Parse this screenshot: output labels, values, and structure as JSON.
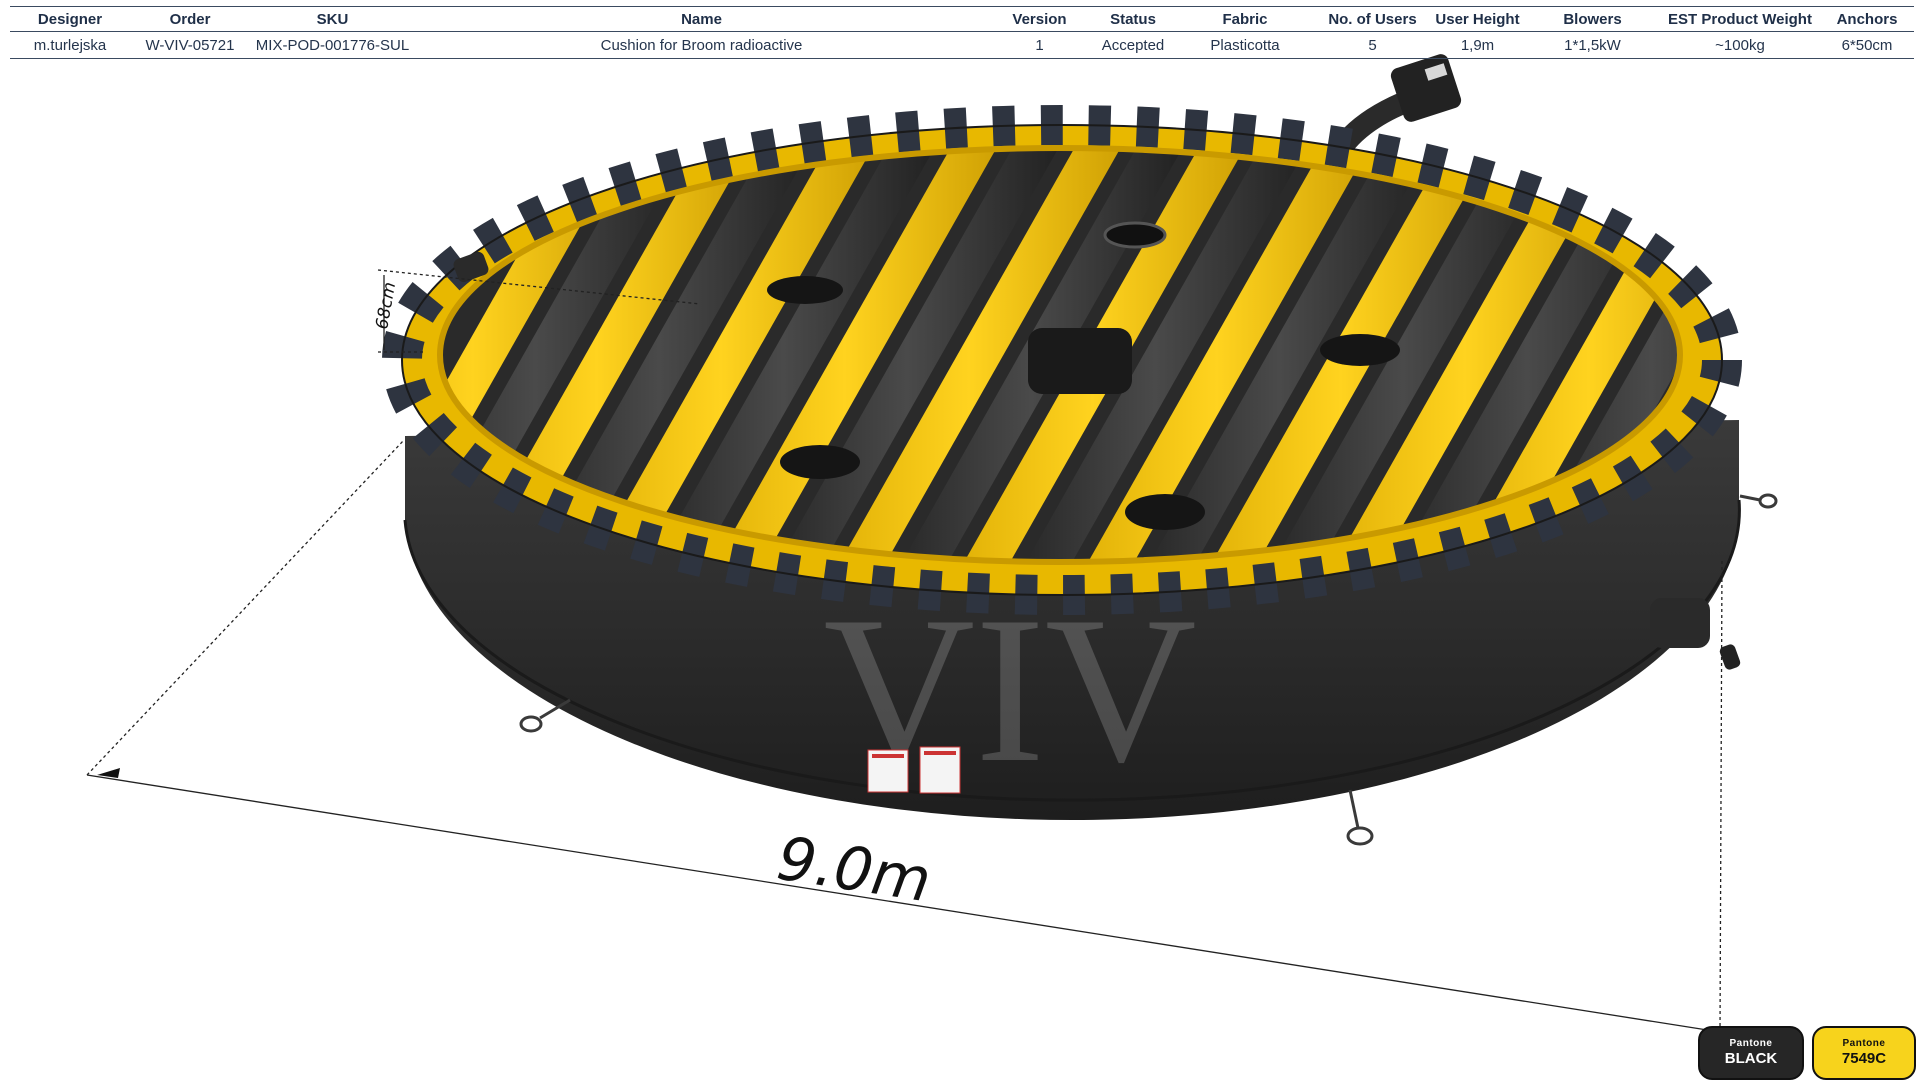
{
  "spec_table": {
    "headers": [
      "Designer",
      "Order",
      "SKU",
      "Name",
      "Version",
      "Status",
      "Fabric",
      "No. of Users",
      "User  Height",
      "Blowers",
      "EST Product Weight",
      "Anchors"
    ],
    "row": [
      "m.turlejska",
      "W-VIV-05721",
      "MIX-POD-001776-SUL",
      "Cushion for Broom radioactive",
      "1",
      "Accepted",
      "Plasticotta",
      "5",
      "1,9m",
      "1*1,5kW",
      "~100kg",
      "6*50cm"
    ]
  },
  "dimensions": {
    "diameter": "9.0m",
    "height": "68cm"
  },
  "watermark": "VIV",
  "colors": {
    "black": "#2b2b2b",
    "yellow": "#f5c415",
    "stripe_dark": "#2e3440"
  },
  "pantone_swatches": [
    {
      "top": "Pantone",
      "bottom": "BLACK",
      "color": "#262626"
    },
    {
      "top": "Pantone",
      "bottom": "7549C",
      "color": "#f7d31c"
    }
  ]
}
